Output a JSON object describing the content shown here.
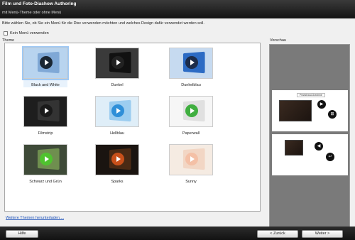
{
  "header": {
    "title": "Film und Foto-Diashow Authoring",
    "subtitle": "mit Menü-Theme oder ohne Menü"
  },
  "instruction": "Bitte wählen Sie, ob Sie ein Menü für die Disc verwenden möchten und welches Design dafür verwendet werden soll.",
  "no_menu_checkbox": {
    "label": "Kein Menü verwenden",
    "checked": false
  },
  "theme_section_label": "Theme",
  "preview_section_label": "Vorschau",
  "themes": [
    {
      "name": "Black and White",
      "selected": true,
      "bg": "#b8d4ef",
      "screen": "#7fa8d6",
      "play": "#1a2633"
    },
    {
      "name": "Dunkel",
      "selected": false,
      "bg": "#3a3a3a",
      "screen": "#111111",
      "play": "#222222"
    },
    {
      "name": "Dunkelblau",
      "selected": false,
      "bg": "#c6daf0",
      "screen": "#2c6bc4",
      "play": "#1c2c4a"
    },
    {
      "name": "Filmstrip",
      "selected": false,
      "bg": "#1e1e1e",
      "screen": "#333333",
      "play": "#1a1a1a"
    },
    {
      "name": "Hellblau",
      "selected": false,
      "bg": "#dfeef8",
      "screen": "#9ccdf0",
      "play": "#2f8fd8"
    },
    {
      "name": "Paperwall",
      "selected": false,
      "bg": "#f6f6f6",
      "screen": "#e0e0e0",
      "play": "#3fae3f"
    },
    {
      "name": "Schwarz und Grün",
      "selected": false,
      "bg": "#3e4a38",
      "screen": "#6f8f4f",
      "play": "#4fc22f"
    },
    {
      "name": "Sparks",
      "selected": false,
      "bg": "#1a1410",
      "screen": "#4a2a14",
      "play": "#c8501a"
    },
    {
      "name": "Sunny",
      "selected": false,
      "bg": "#f5ebe2",
      "screen": "#f2d6c4",
      "play": "#f4c0a6"
    }
  ],
  "preview": {
    "menu_title": "Prankhwal-Gravhine",
    "nav_next_icon": "play-icon",
    "nav_grid_icon": "grid-icon",
    "nav_prev_icon": "back-icon",
    "nav_return_icon": "return-icon"
  },
  "more_themes_link": "Weitere Themen herunterladen....",
  "footer": {
    "help_label": "Hilfe",
    "back_label": "< Zurück",
    "next_label": "Weiter >"
  }
}
